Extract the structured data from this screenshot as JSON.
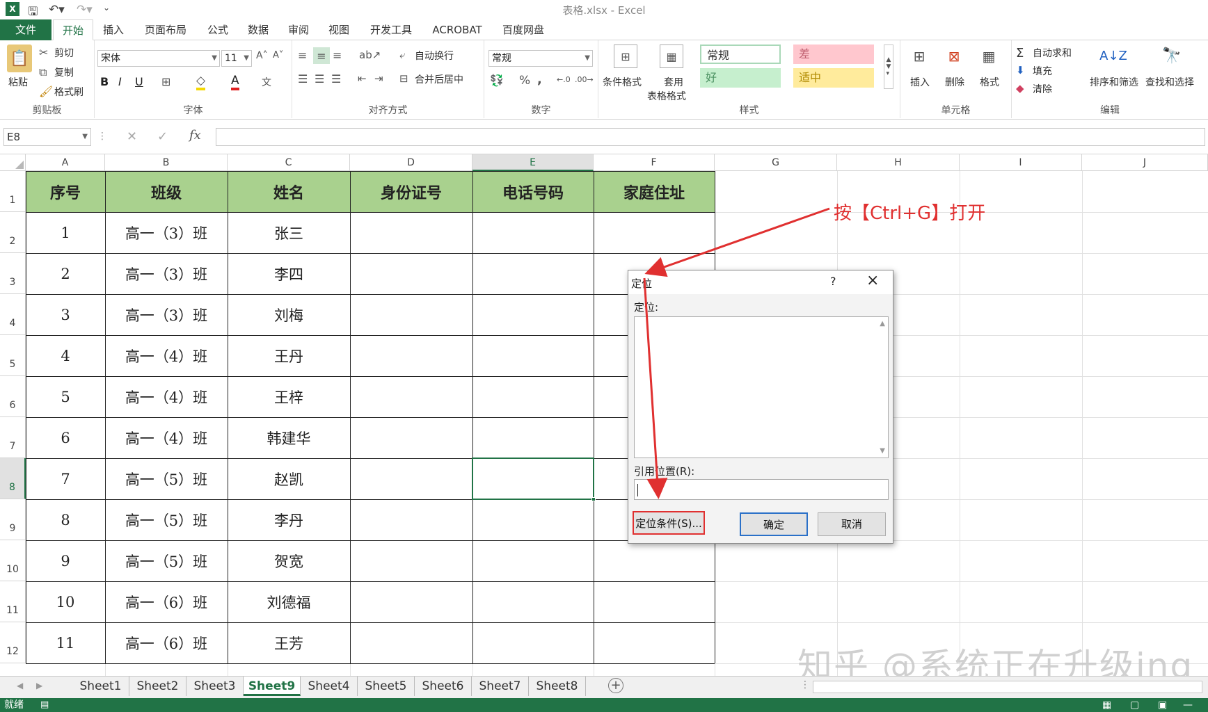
{
  "app": {
    "title": "表格.xlsx - Excel"
  },
  "tabs": {
    "file": "文件",
    "home": "开始",
    "insert": "插入",
    "layout": "页面布局",
    "formula": "公式",
    "data": "数据",
    "review": "审阅",
    "view": "视图",
    "dev": "开发工具",
    "acrobat": "ACROBAT",
    "baidu": "百度网盘"
  },
  "ribbon": {
    "paste": "粘贴",
    "cut": "剪切",
    "copy": "复制",
    "painter": "格式刷",
    "clipboard": "剪贴板",
    "font_name": "宋体",
    "font_size": "11",
    "bold": "B",
    "italic": "I",
    "underline": "U",
    "font_group": "字体",
    "wrap": "自动换行",
    "merge": "合并后居中",
    "align_group": "对齐方式",
    "number_format": "常规",
    "percent": "%",
    "comma": ",",
    "number_group": "数字",
    "cond_format": "条件格式",
    "table_format_1": "套用",
    "table_format_2": "表格格式",
    "style_normal": "常规",
    "style_bad": "差",
    "style_good": "好",
    "style_neutral": "适中",
    "styles_group": "样式",
    "insert": "插入",
    "delete": "删除",
    "format": "格式",
    "cells_group": "单元格",
    "autosum": "自动求和",
    "fill": "填充",
    "clear": "清除",
    "sort": "排序和筛选",
    "find": "查找和选择",
    "edit_group": "编辑"
  },
  "formula_bar": {
    "name_box": "E8",
    "fx": "fx"
  },
  "columns": [
    "A",
    "B",
    "C",
    "D",
    "E",
    "F",
    "G",
    "H",
    "I",
    "J"
  ],
  "rows": [
    "1",
    "2",
    "3",
    "4",
    "5",
    "6",
    "7",
    "8",
    "9",
    "10",
    "11",
    "12"
  ],
  "table": {
    "headers": [
      "序号",
      "班级",
      "姓名",
      "身份证号",
      "电话号码",
      "家庭住址"
    ],
    "rows": [
      [
        "1",
        "高一（3）班",
        "张三"
      ],
      [
        "2",
        "高一（3）班",
        "李四"
      ],
      [
        "3",
        "高一（3）班",
        "刘梅"
      ],
      [
        "4",
        "高一（4）班",
        "王丹"
      ],
      [
        "5",
        "高一（4）班",
        "王梓"
      ],
      [
        "6",
        "高一（4）班",
        "韩建华"
      ],
      [
        "7",
        "高一（5）班",
        "赵凯"
      ],
      [
        "8",
        "高一（5）班",
        "李丹"
      ],
      [
        "9",
        "高一（5）班",
        "贺宽"
      ],
      [
        "10",
        "高一（6）班",
        "刘德福"
      ],
      [
        "11",
        "高一（6）班",
        "王芳"
      ]
    ]
  },
  "annotation": "按【Ctrl+G】打开",
  "dialog": {
    "title": "定位",
    "help": "?",
    "list_label": "定位:",
    "ref_label": "引用位置(R):",
    "special_button": "定位条件(S)...",
    "ok": "确定",
    "cancel": "取消"
  },
  "sheets": [
    "Sheet1",
    "Sheet2",
    "Sheet3",
    "Sheet9",
    "Sheet4",
    "Sheet5",
    "Sheet6",
    "Sheet7",
    "Sheet8"
  ],
  "active_sheet": "Sheet9",
  "status": {
    "ready": "就绪"
  },
  "watermark": "知乎 @系统正在升级ing",
  "colors": {
    "excel_green": "#217346",
    "header_fill": "#a9d18e",
    "arrow": "#e03030"
  }
}
